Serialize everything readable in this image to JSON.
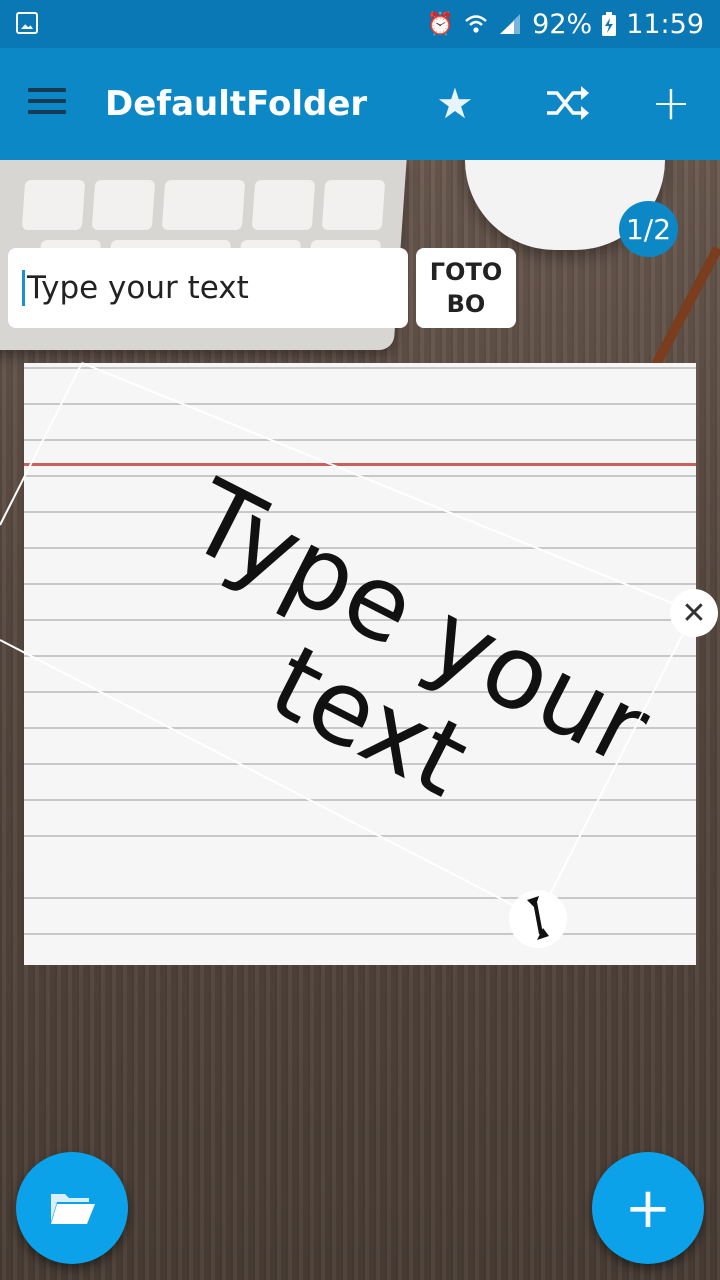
{
  "status_bar": {
    "battery": "92%",
    "time": "11:59",
    "icons": [
      "gallery-icon",
      "alarm-icon",
      "wifi-icon",
      "signal-icon",
      "battery-charging-icon"
    ]
  },
  "app_bar": {
    "title": "DefaultFolder",
    "icons": [
      "menu-icon",
      "star-icon",
      "shuffle-icon",
      "plus-icon"
    ],
    "accent_color": "#0d88c6"
  },
  "pager": {
    "label": "1/2"
  },
  "editor": {
    "input_value": "Type your text",
    "done_label": "ГОТОВО"
  },
  "card": {
    "text": "Type your text",
    "style": "lined-notebook-paper"
  },
  "handles": {
    "close": "close-icon",
    "resize": "resize-arrows-icon"
  },
  "fabs": {
    "folder": "folder-icon",
    "add": "add-icon",
    "color": "#0ba2ea"
  }
}
